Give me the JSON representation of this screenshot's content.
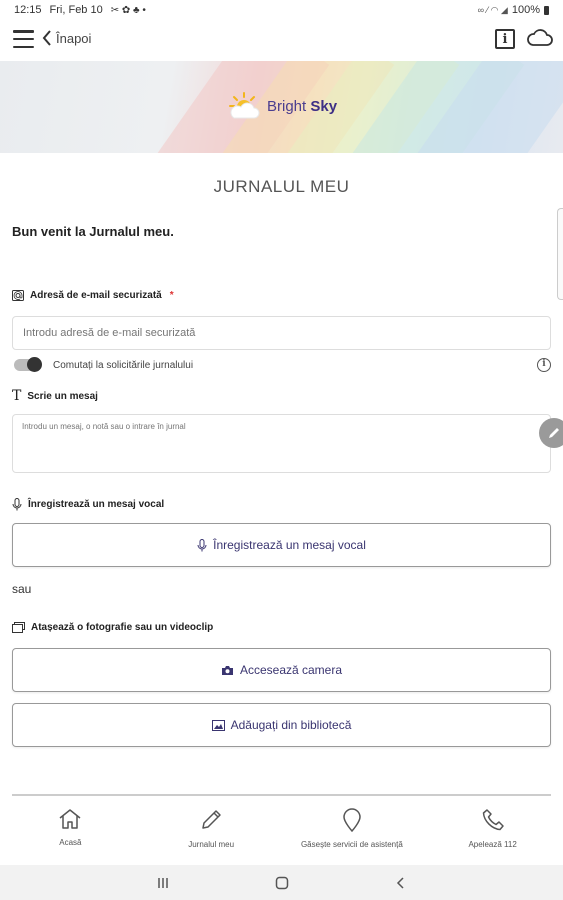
{
  "status_bar": {
    "time": "12:15",
    "date": "Fri, Feb 10",
    "battery": "100%"
  },
  "header": {
    "back_label": "Înapoi",
    "info_glyph": "i"
  },
  "banner": {
    "logo_word1": "Bright",
    "logo_word2": "Sky"
  },
  "page": {
    "title": "JURNALUL MEU",
    "welcome": "Bun venit la Jurnalul meu."
  },
  "email": {
    "label": "Adresă de e-mail securizată",
    "required_mark": "*",
    "placeholder": "Introdu adresă de e-mail securizată"
  },
  "toggle": {
    "label": "Comutați la solicitările jurnalului",
    "on": false
  },
  "message": {
    "label": "Scrie un mesaj",
    "placeholder": "Introdu un mesaj, o notă sau o intrare în jurnal"
  },
  "voice": {
    "label": "Înregistrează un mesaj vocal",
    "button_label": "Înregistrează un mesaj vocal"
  },
  "or_text": "sau",
  "attach": {
    "label": "Atașează o fotografie sau un videoclip",
    "camera_button": "Accesează camera",
    "library_button": "Adăugați din bibliotecă"
  },
  "bottom_nav": {
    "items": [
      {
        "label": "Acasă",
        "icon": "home-icon"
      },
      {
        "label": "Jurnalul meu",
        "icon": "pencil-icon"
      },
      {
        "label": "Găsește servicii de asistență",
        "icon": "location-pin-icon"
      },
      {
        "label": "Apelează 112",
        "icon": "phone-icon"
      }
    ]
  },
  "colors": {
    "accent": "#3a3570",
    "logo": "#4a3d8f",
    "required": "#dd3333"
  }
}
